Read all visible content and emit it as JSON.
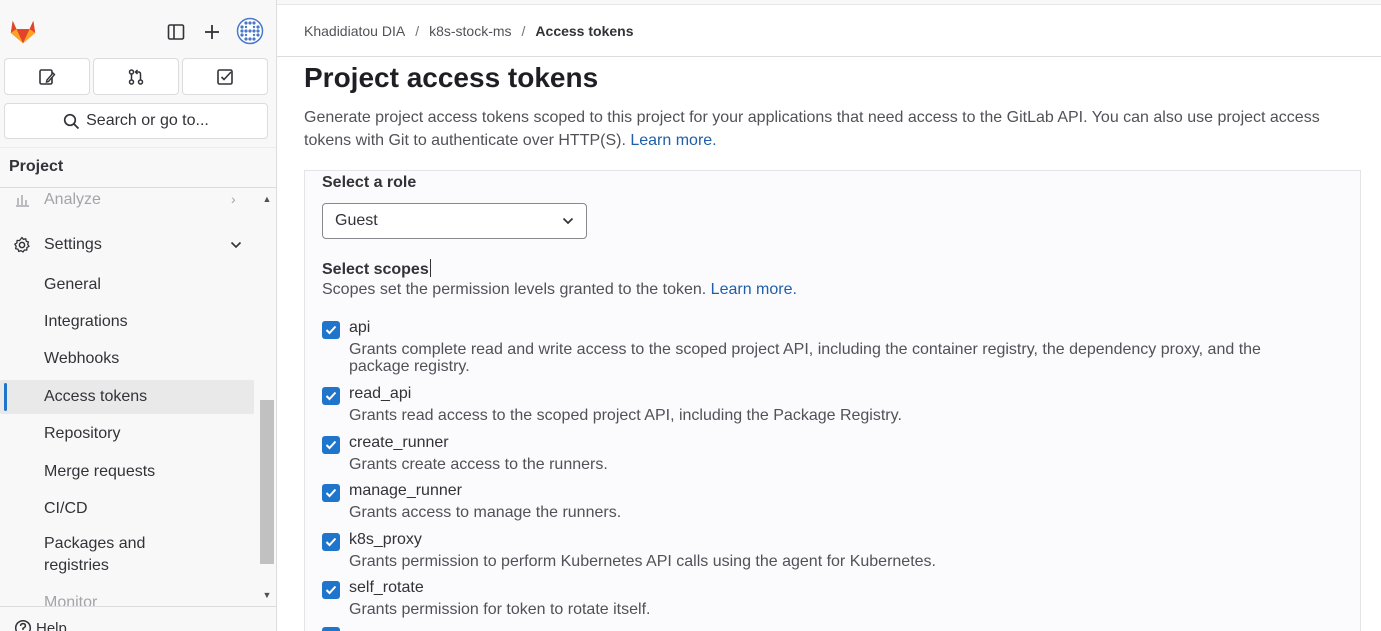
{
  "sidebar": {
    "search_label": "Search or go to...",
    "section_title": "Project",
    "nav": {
      "analyze": "Analyze",
      "settings": "Settings",
      "items": [
        "General",
        "Integrations",
        "Webhooks",
        "Access tokens",
        "Repository",
        "Merge requests",
        "CI/CD"
      ],
      "packages_line1": "Packages and",
      "packages_line2": "registries",
      "monitor": "Monitor"
    },
    "help": "Help"
  },
  "breadcrumb": {
    "owner": "Khadidiatou DIA",
    "project": "k8s-stock-ms",
    "current": "Access tokens"
  },
  "page": {
    "title": "Project access tokens",
    "description": "Generate project access tokens scoped to this project for your applications that need access to the GitLab API. You can also use project access tokens with Git to authenticate over HTTP(S).",
    "learn_more": "Learn more.",
    "role_label": "Select a role",
    "role_value": "Guest",
    "scopes_label": "Select scopes",
    "scopes_help": "Scopes set the permission levels granted to the token.",
    "scopes_learn_more": "Learn more."
  },
  "scopes": [
    {
      "name": "api",
      "desc": "Grants complete read and write access to the scoped project API, including the container registry, the dependency proxy, and the package registry.",
      "checked": true
    },
    {
      "name": "read_api",
      "desc": "Grants read access to the scoped project API, including the Package Registry.",
      "checked": true
    },
    {
      "name": "create_runner",
      "desc": "Grants create access to the runners.",
      "checked": true
    },
    {
      "name": "manage_runner",
      "desc": "Grants access to manage the runners.",
      "checked": true
    },
    {
      "name": "k8s_proxy",
      "desc": "Grants permission to perform Kubernetes API calls using the agent for Kubernetes.",
      "checked": true
    },
    {
      "name": "self_rotate",
      "desc": "Grants permission for token to rotate itself.",
      "checked": true
    }
  ],
  "colors": {
    "accent": "#1f75cb",
    "link": "#1f5fa8",
    "logo_orange": "#e24329",
    "logo_light": "#fc6d26",
    "logo_yellow": "#fca326"
  }
}
